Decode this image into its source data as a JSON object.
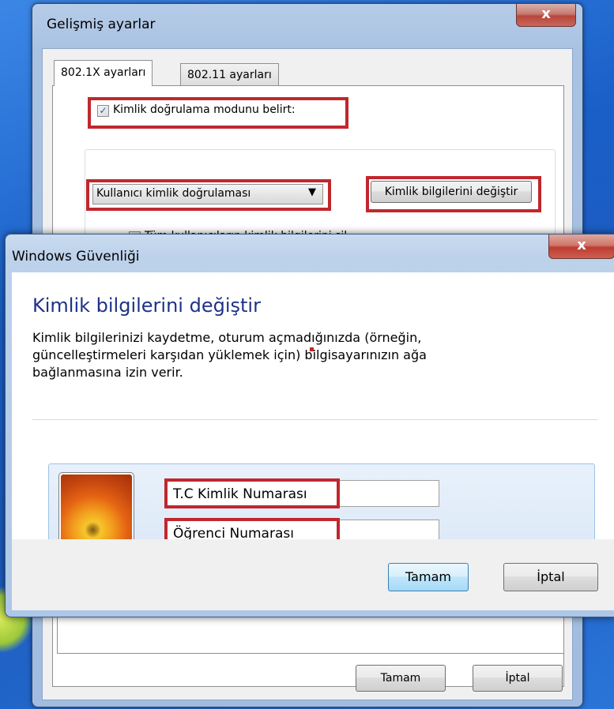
{
  "advanced_window": {
    "title": "Gelişmiş ayarlar",
    "close_label": "x",
    "tabs": [
      {
        "label": "802.1X ayarları",
        "active": true
      },
      {
        "label": "802.11 ayarları",
        "active": false
      }
    ],
    "specify_auth_mode": {
      "label": "Kimlik doğrulama modunu belirt:",
      "checked": true
    },
    "auth_mode_dropdown": {
      "value": "Kullanıcı kimlik doğrulaması"
    },
    "replace_credentials_button": "Kimlik bilgilerini değiştir",
    "delete_all_credentials": {
      "label": "Tüm kullanıcıların kimlik bilgilerini sil",
      "checked": false
    },
    "ok_button": "Tamam",
    "cancel_button": "İptal"
  },
  "security_window": {
    "title": "Windows Güvenliği",
    "close_label": "x",
    "heading": "Kimlik bilgilerini değiştir",
    "description_lines": [
      "Kimlik bilgilerinizi kaydetme, oturum açmadığınızda (örneğin,",
      "güncelleştirmeleri karşıdan yüklemek için) bilgisayarınızın ağa",
      "bağlanmasına izin verir."
    ],
    "username_field": {
      "value": "T.C Kimlik Numarası"
    },
    "password_field": {
      "value": "Öğrenci Numarası"
    },
    "ok_button": "Tamam",
    "cancel_button": "İptal"
  },
  "colors": {
    "highlight": "#c0272d",
    "heading": "#1e3287",
    "title_bar": "#bcd1ea"
  }
}
